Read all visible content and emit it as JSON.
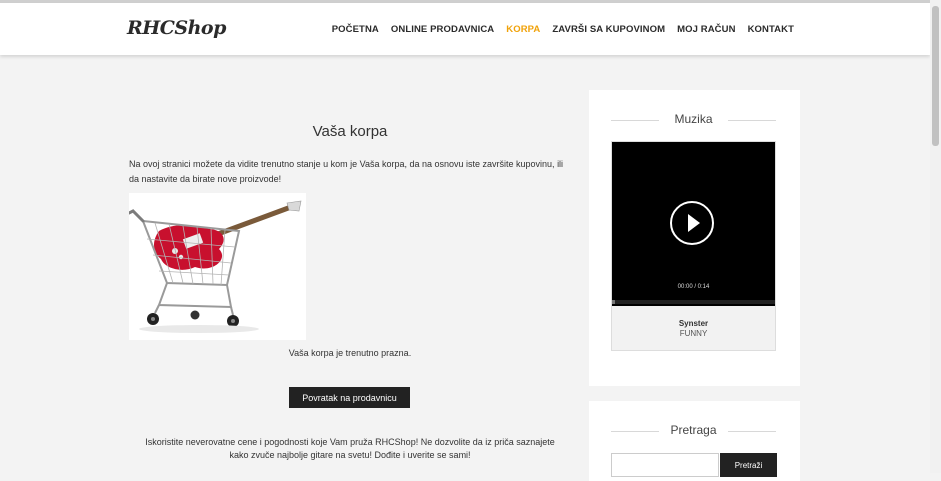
{
  "brand": {
    "logo": "RHCShop"
  },
  "nav": {
    "items": [
      {
        "label": "POČETNA"
      },
      {
        "label": "ONLINE PRODAVNICA"
      },
      {
        "label": "KORPA"
      },
      {
        "label": "ZAVRŠI SA KUPOVINOM"
      },
      {
        "label": "MOJ RAČUN"
      },
      {
        "label": "KONTAKT"
      }
    ],
    "active_item": "KORPA",
    "accent_color": "#f0a20a"
  },
  "main": {
    "title": "Vaša korpa",
    "intro": "Na ovoj stranici možete da vidite trenutno stanje u kom je Vaša korpa, da na osnovu iste završite kupovinu, ili da nastavite da birate nove proizvode!",
    "empty_message": "Vaša korpa je trenutno prazna.",
    "back_button": "Povratak na prodavnicu",
    "promo_line1": "Iskoristite neverovatne cene i pogodnosti koje Vam pruža RHCShop! Ne dozvolite da iz priča saznajete",
    "promo_line2": "kako zvuče najbolje gitare na svetu! Dođite i uverite se sami!"
  },
  "sidebar": {
    "music": {
      "title": "Muzika",
      "time": "00:00 / 0:14",
      "progress": 0,
      "track_name": "Synster",
      "track_artist": "FUNNY"
    },
    "search": {
      "title": "Pretraga",
      "input_value": "",
      "button_label": "Pretraži"
    }
  }
}
